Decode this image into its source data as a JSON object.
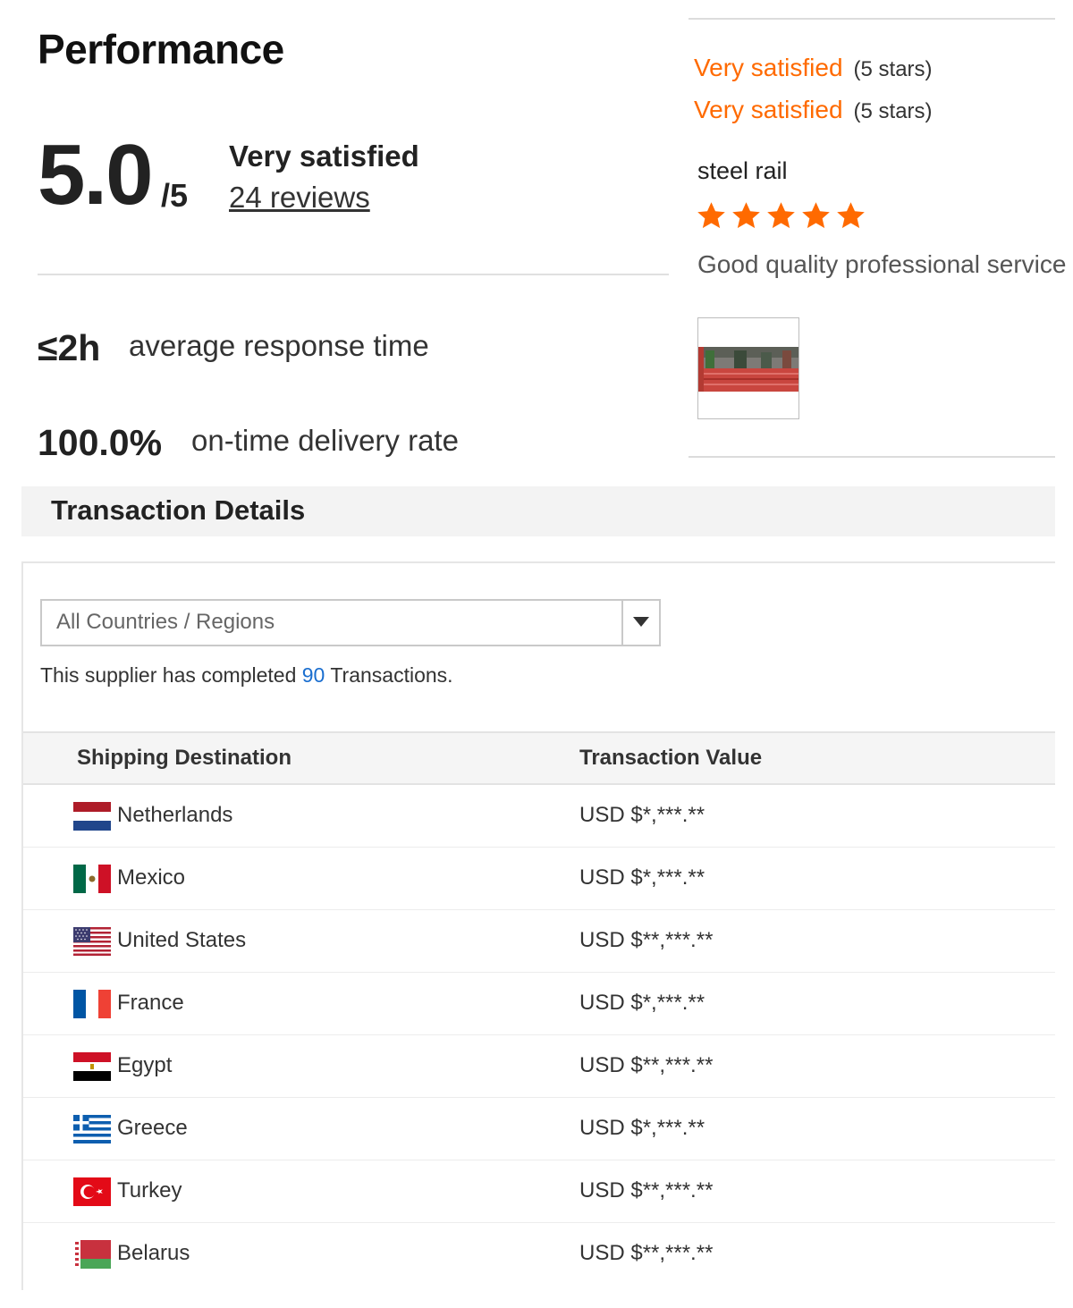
{
  "performance": {
    "title": "Performance",
    "score": "5.0",
    "score_max": "/5",
    "satisfaction_label": "Very satisfied",
    "reviews_link": "24 reviews",
    "response_time_value": "≤2h",
    "response_time_label": "average response time",
    "delivery_rate_value": "100.0%",
    "delivery_rate_label": "on-time delivery rate"
  },
  "review_card": {
    "ratings": [
      {
        "label": "Very satisfied",
        "stars_text": "(5 stars)"
      },
      {
        "label": "Very satisfied",
        "stars_text": "(5 stars)"
      }
    ],
    "product_name": "steel rail",
    "star_count": 5,
    "star_color": "#ff6a00",
    "review_text": "Good quality professional service"
  },
  "transactions": {
    "title": "Transaction Details",
    "filter": {
      "selected": "All Countries / Regions"
    },
    "summary_prefix": "This supplier has completed ",
    "summary_count": "90",
    "summary_suffix": " Transactions.",
    "columns": [
      "Shipping Destination",
      "Transaction Value"
    ],
    "rows": [
      {
        "country": "Netherlands",
        "flag": "netherlands-flag-icon",
        "value": "USD $*,***.**"
      },
      {
        "country": "Mexico",
        "flag": "mexico-flag-icon",
        "value": "USD $*,***.**"
      },
      {
        "country": "United States",
        "flag": "united-states-flag-icon",
        "value": "USD $**,***.**"
      },
      {
        "country": "France",
        "flag": "france-flag-icon",
        "value": "USD $*,***.**"
      },
      {
        "country": "Egypt",
        "flag": "egypt-flag-icon",
        "value": "USD $**,***.**"
      },
      {
        "country": "Greece",
        "flag": "greece-flag-icon",
        "value": "USD $*,***.**"
      },
      {
        "country": "Turkey",
        "flag": "turkey-flag-icon",
        "value": "USD $**,***.**"
      },
      {
        "country": "Belarus",
        "flag": "belarus-flag-icon",
        "value": "USD $**,***.**"
      }
    ]
  },
  "colors": {
    "accent": "#ff6a00",
    "link_blue": "#1a6ecf"
  }
}
